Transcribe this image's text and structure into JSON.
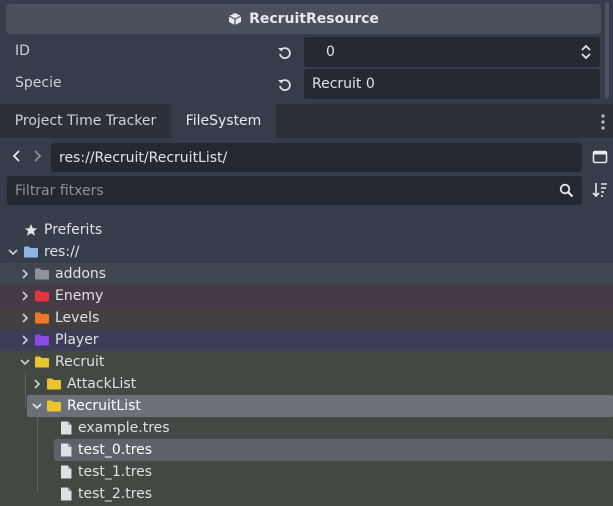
{
  "inspector": {
    "resource_name": "RecruitResource",
    "properties": [
      {
        "label": "ID",
        "value": "0"
      },
      {
        "label": "Specie",
        "value": "Recruit 0"
      }
    ]
  },
  "dock": {
    "tabs": [
      {
        "label": "Project Time Tracker",
        "active": false
      },
      {
        "label": "FileSystem",
        "active": true
      }
    ]
  },
  "filesystem": {
    "path": "res://Recruit/RecruitList/",
    "filter_placeholder": "Filtrar fitxers",
    "tree": {
      "favorites": "Preferits",
      "root": "res://",
      "folders": [
        {
          "name": "addons",
          "color": "#8f949c",
          "expanded": false
        },
        {
          "name": "Enemy",
          "color": "#e0373e",
          "expanded": false
        },
        {
          "name": "Levels",
          "color": "#e9782a",
          "expanded": false
        },
        {
          "name": "Player",
          "color": "#8a4ae4",
          "expanded": false
        },
        {
          "name": "Recruit",
          "color": "#e8c531",
          "expanded": true,
          "children": [
            {
              "name": "AttackList",
              "expanded": false
            },
            {
              "name": "RecruitList",
              "expanded": true,
              "selected": true,
              "files": [
                "example.tres",
                "test_0.tres",
                "test_1.tres",
                "test_2.tres"
              ]
            }
          ]
        }
      ]
    }
  },
  "colors": {
    "background": "#363d4a",
    "field": "#242830",
    "selection": "#6b7079",
    "folder_default": "#8fb6e0"
  }
}
